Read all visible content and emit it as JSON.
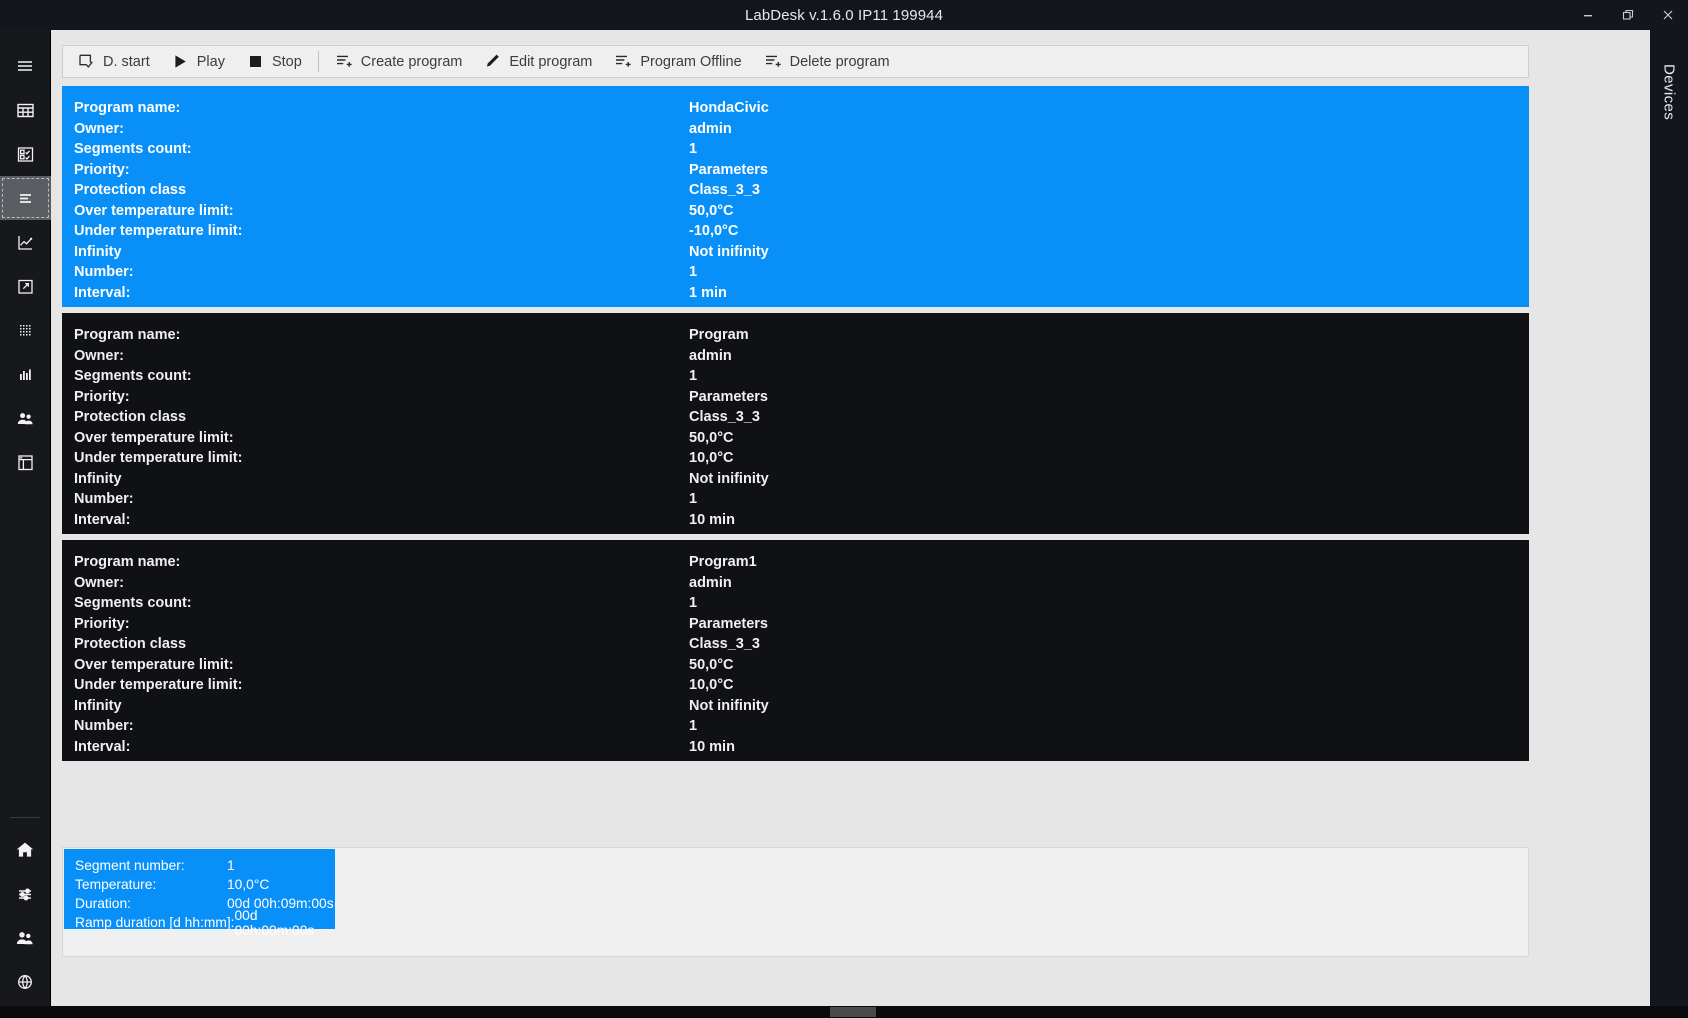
{
  "window": {
    "title": "LabDesk v.1.6.0 IP11 199944",
    "controls": [
      {
        "name": "minimize",
        "glyph": "minimize-icon"
      },
      {
        "name": "restore",
        "glyph": "restore-icon"
      },
      {
        "name": "close",
        "glyph": "close-icon"
      }
    ]
  },
  "sidebar": {
    "items": [
      {
        "icon": "hamburger-menu-icon",
        "name": "menu",
        "selected": false
      },
      {
        "icon": "grid-table-icon",
        "name": "table",
        "selected": false
      },
      {
        "icon": "checklist-icon",
        "name": "checklist",
        "selected": false
      },
      {
        "icon": "program-list-icon",
        "name": "programs",
        "selected": true
      },
      {
        "icon": "line-chart-icon",
        "name": "charts",
        "selected": false
      },
      {
        "icon": "export-icon",
        "name": "export",
        "selected": false
      },
      {
        "icon": "dotted-grid-icon",
        "name": "calibration",
        "selected": false
      },
      {
        "icon": "bar-chart-icon",
        "name": "statistics",
        "selected": false
      },
      {
        "icon": "users-icon",
        "name": "users",
        "selected": false
      },
      {
        "icon": "device-icon",
        "name": "device",
        "selected": false
      }
    ],
    "bottom_items": [
      {
        "icon": "home-icon",
        "name": "home"
      },
      {
        "icon": "sliders-icon",
        "name": "settings"
      },
      {
        "icon": "users-icon",
        "name": "accounts"
      },
      {
        "icon": "globe-icon",
        "name": "language"
      }
    ]
  },
  "devices_rail": {
    "label": "Devices"
  },
  "toolbar": {
    "buttons": [
      {
        "label": "D. start",
        "icon": "deferred-start-icon"
      },
      {
        "label": "Play",
        "icon": "play-icon"
      },
      {
        "label": "Stop",
        "icon": "stop-icon"
      },
      {
        "label": "Create program",
        "icon": "create-program-icon"
      },
      {
        "label": "Edit program",
        "icon": "edit-program-icon"
      },
      {
        "label": "Program Offline",
        "icon": "program-offline-icon"
      },
      {
        "label": "Delete program",
        "icon": "delete-program-icon"
      }
    ]
  },
  "labels": {
    "program_name": "Program name:",
    "owner": "Owner:",
    "segments_count": "Segments count:",
    "priority": "Priority:",
    "protection_class": "Protection class",
    "over_temperature_limit": "Over temperature limit:",
    "under_temperature_limit": "Under temperature limit:",
    "infinity": "Infinity",
    "number": "Number:",
    "interval": "Interval:"
  },
  "programs": [
    {
      "selected": true,
      "program_name": "HondaCivic",
      "owner": "admin",
      "segments_count": "1",
      "priority": "Parameters",
      "protection_class": "Class_3_3",
      "over_temperature_limit": "50,0°C",
      "under_temperature_limit": "-10,0°C",
      "infinity": "Not inifinity",
      "number": "1",
      "interval": "1 min"
    },
    {
      "selected": false,
      "program_name": "Program",
      "owner": "admin",
      "segments_count": "1",
      "priority": "Parameters",
      "protection_class": "Class_3_3",
      "over_temperature_limit": "50,0°C",
      "under_temperature_limit": "10,0°C",
      "infinity": "Not inifinity",
      "number": "1",
      "interval": "10 min"
    },
    {
      "selected": false,
      "program_name": "Program1",
      "owner": "admin",
      "segments_count": "1",
      "priority": "Parameters",
      "protection_class": "Class_3_3",
      "over_temperature_limit": "50,0°C",
      "under_temperature_limit": "10,0°C",
      "infinity": "Not inifinity",
      "number": "1",
      "interval": "10 min"
    }
  ],
  "segment": {
    "segment_number_label": "Segment number:",
    "segment_number_value": "1",
    "temperature_label": "Temperature:",
    "temperature_value": "10,0°C",
    "duration_label": "Duration:",
    "duration_value": "00d 00h:09m:00s",
    "ramp_label": "Ramp duration [d hh:mm]:",
    "ramp_value": "00d 00h:00m:00s"
  },
  "colors": {
    "accent": "#0890f8",
    "card_bg": "#101114",
    "chrome_dark": "#14161d",
    "pane_bg": "#e6e6e6"
  }
}
